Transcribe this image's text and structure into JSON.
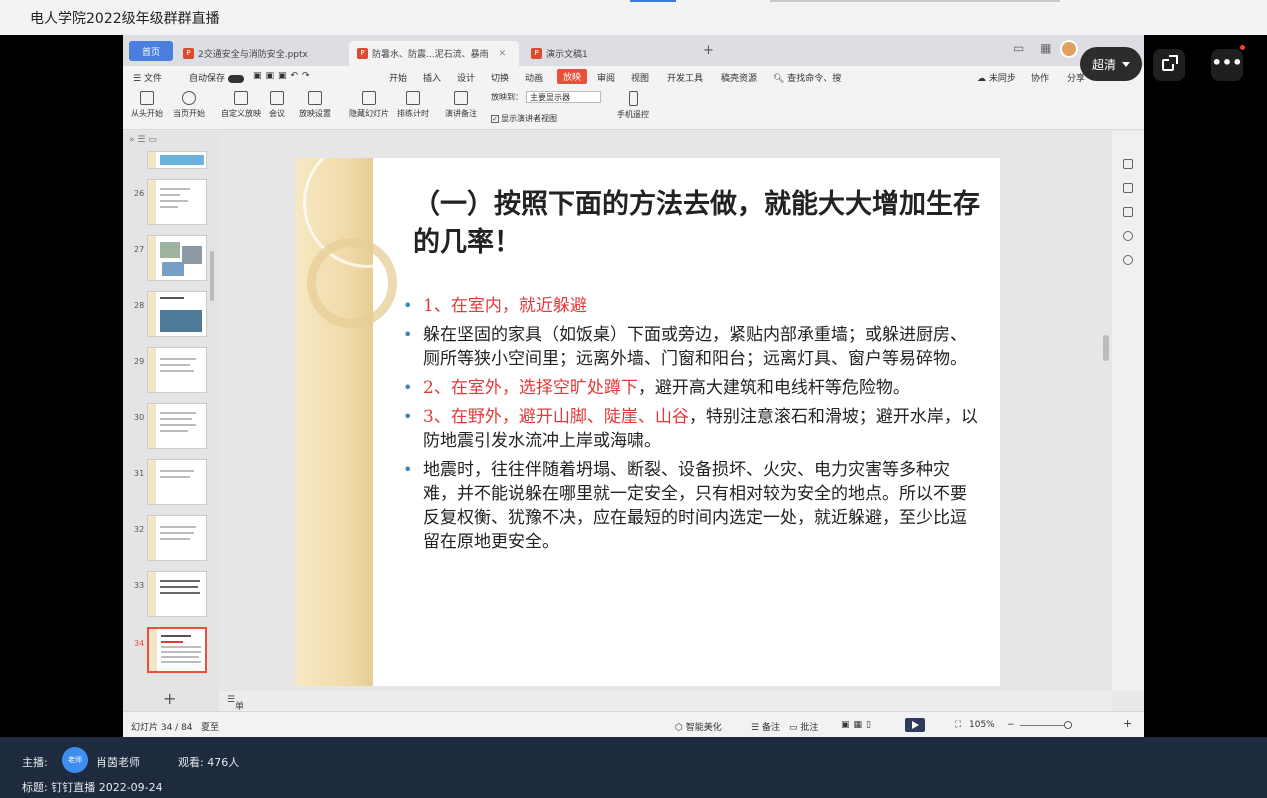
{
  "window": {
    "title": "电人学院2022级年级群群直播"
  },
  "ppt": {
    "tabs": {
      "home": "首页",
      "tab1": "2交通安全与消防安全.pptx",
      "tab2": "防暑水、防震...泥石流、暴雨",
      "tab3": "演示文稿1",
      "plus": "+"
    },
    "menu": {
      "file": "文件",
      "autosave": "自动保存",
      "start": "开始",
      "insert": "插入",
      "design": "设计",
      "switch": "切换",
      "animation": "动画",
      "slideshow": "放映",
      "review": "审阅",
      "view": "视图",
      "devtools": "开发工具",
      "special": "稿壳资源",
      "search": "查找命令、搜",
      "unsynced": "未同步",
      "collab": "协作",
      "share": "分享"
    },
    "ribbon": {
      "from_start": "从头开始",
      "from_current": "当页开始",
      "custom_show": "自定义放映",
      "meeting": "会议",
      "show_settings": "放映设置",
      "hide_slide": "隐藏幻灯片",
      "rehearse": "排练计时",
      "speaker_notes": "演讲备注",
      "show_on_label": "放映到：",
      "show_on_value": "主要显示器",
      "presenter_view": "显示演讲者视图",
      "phone_remote": "手机遥控"
    },
    "thumbnails": [
      "26",
      "27",
      "28",
      "29",
      "30",
      "31",
      "32",
      "33",
      "34"
    ],
    "slide": {
      "title": "（一）按照下面的方法去做，就能大大增加生存的几率！",
      "b1": "1、在室内，就近躲避",
      "b2": "躲在坚固的家具（如饭桌）下面或旁边，紧贴内部承重墙；或躲进厨房、厕所等狭小空间里；远离外墙、门窗和阳台；远离灯具、窗户等易碎物。",
      "b3_red": "2、在室外，选择空旷处蹲下",
      "b3_black": "，避开高大建筑和电线杆等危险物。",
      "b4_red": "3、在野外，避开山脚、陡崖、山谷",
      "b4_black": "，特别注意滚石和滑坡；避开水岸，以防地震引发水流冲上岸或海啸。",
      "b5": "地震时，往往伴随着坍塌、断裂、设备损坏、火灾、电力灾害等多种灾难，并不能说躲在哪里就一定安全，只有相对较为安全的地点。所以不要反复权衡、犹豫不决，应在最短的时间内选定一处，就近躲避，至少比逗留在原地更安全。"
    },
    "notes_placeholder": "单击此处添加备注",
    "status": {
      "slide_count": "幻灯片 34 / 84",
      "theme": "夏至",
      "beautify": "智能美化",
      "notes": "备注",
      "comments": "批注",
      "zoom": "105%"
    }
  },
  "live": {
    "quality": "超清",
    "host_label": "主播:",
    "host_badge": "老师",
    "host_name": "肖茵老师",
    "viewers": "观看: 476人",
    "title_line": "标题: 钉钉直播 2022-09-24"
  }
}
